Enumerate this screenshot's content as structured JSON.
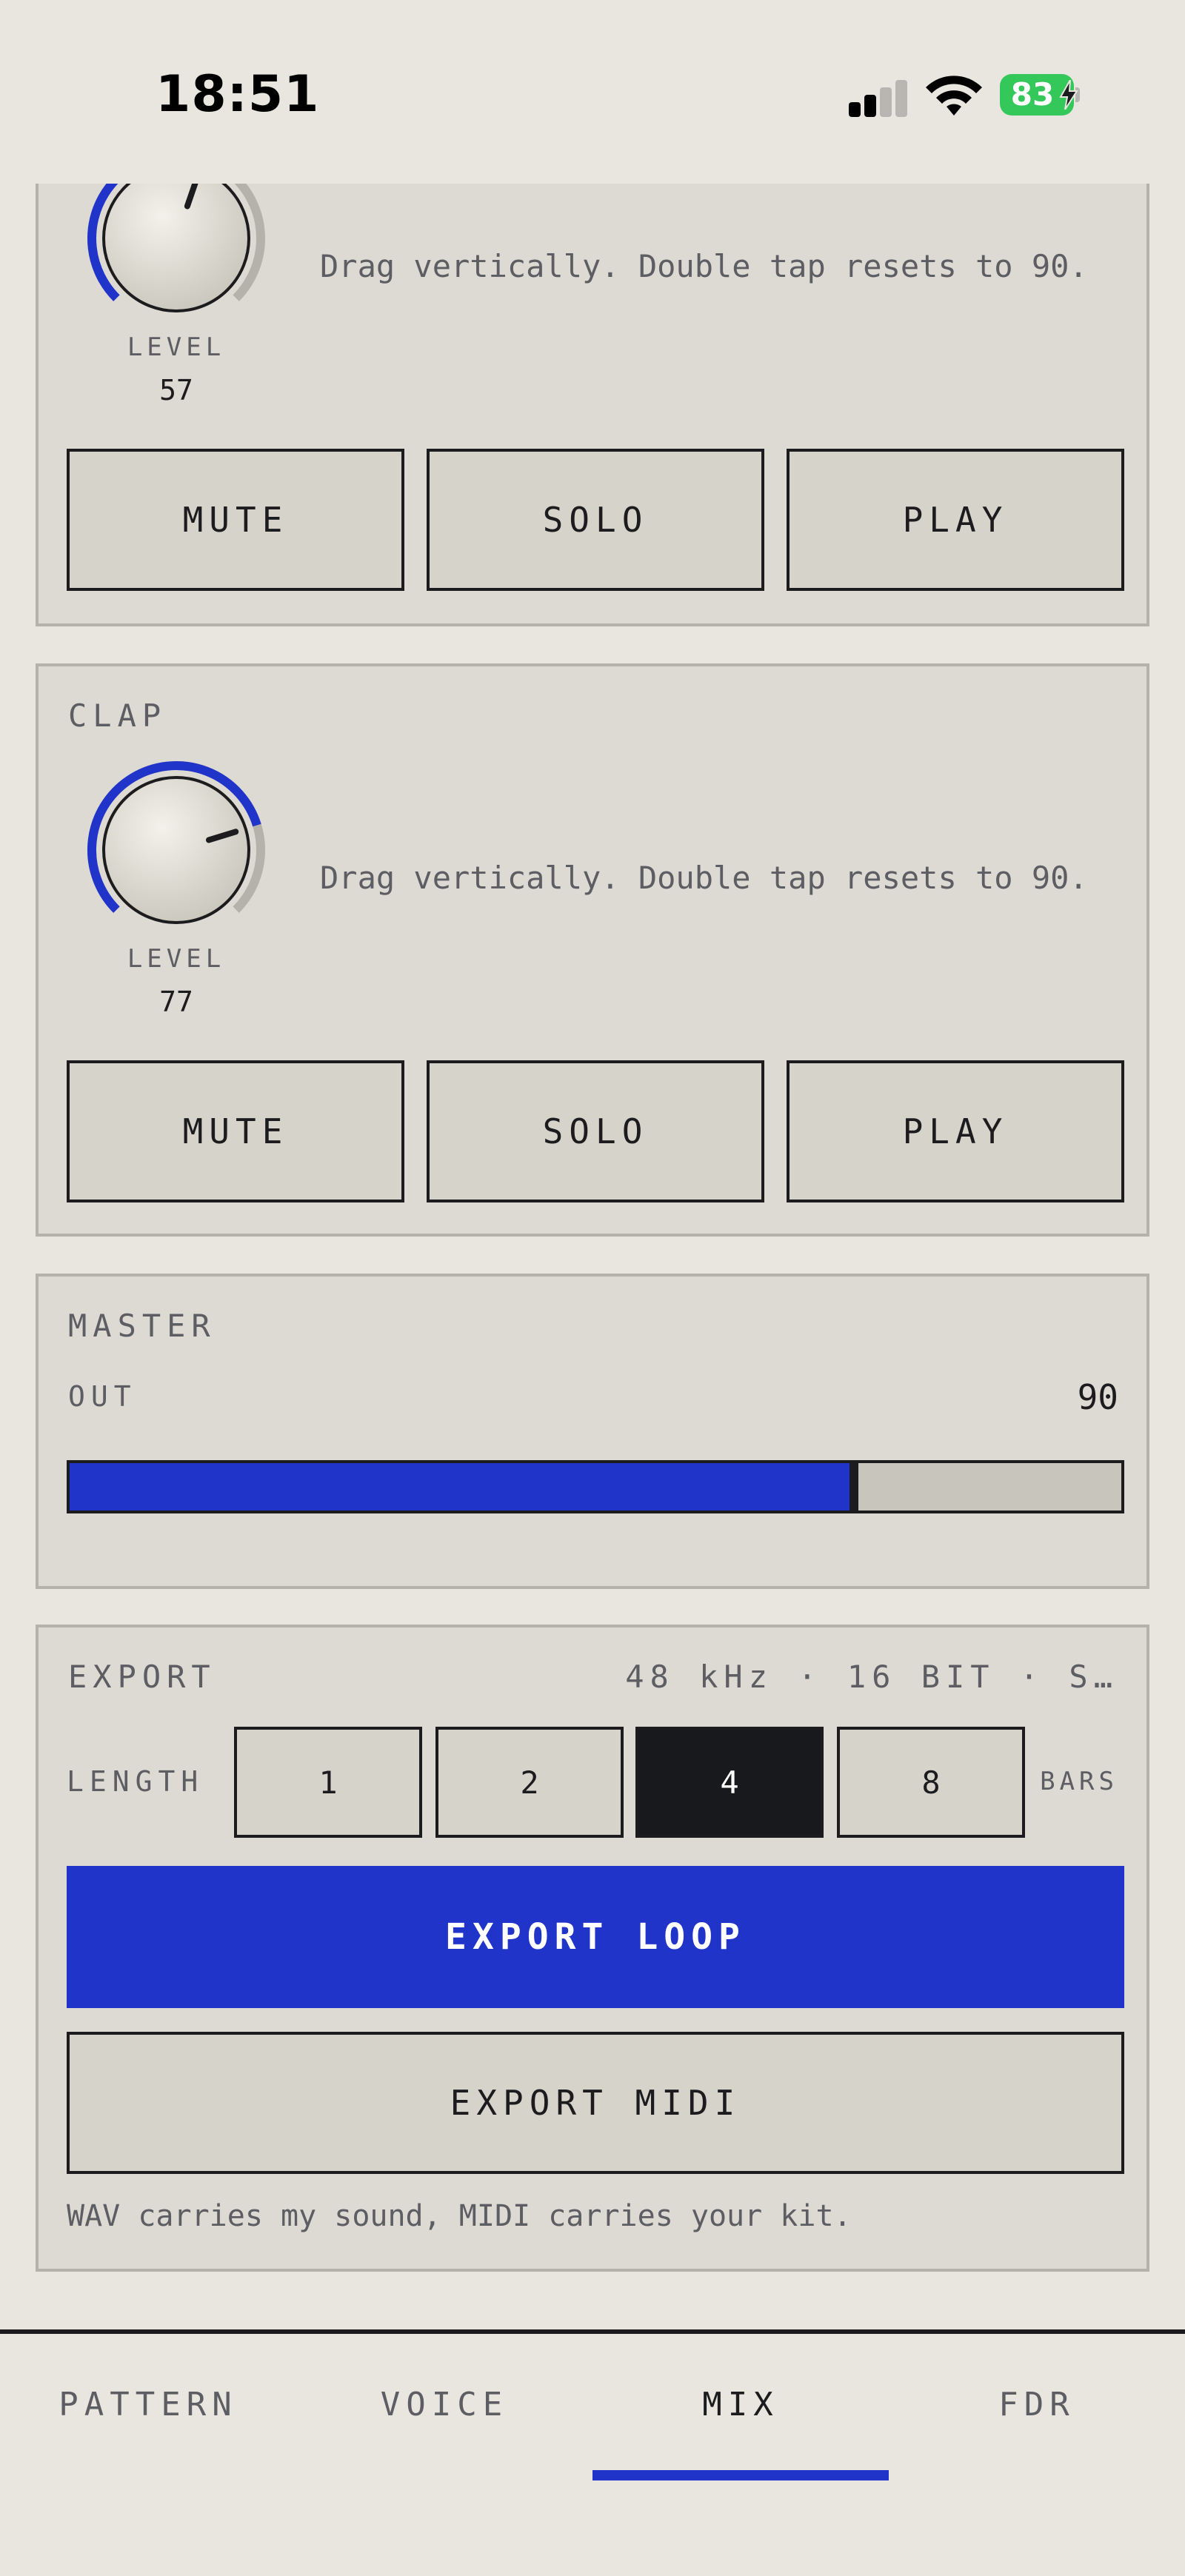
{
  "status_bar": {
    "time": "18:51",
    "battery": "83",
    "icons": [
      "signal-icon",
      "wifi-icon",
      "battery-icon",
      "charging-bolt-icon"
    ]
  },
  "channels": [
    {
      "label": "",
      "knob_label": "LEVEL",
      "level": "57",
      "level_value": 57,
      "hint": "Drag vertically. Double tap resets to 90.",
      "buttons": {
        "mute": "MUTE",
        "solo": "SOLO",
        "play": "PLAY"
      }
    },
    {
      "label": "CLAP",
      "knob_label": "LEVEL",
      "level": "77",
      "level_value": 77,
      "hint": "Drag vertically. Double tap resets to 90.",
      "buttons": {
        "mute": "MUTE",
        "solo": "SOLO",
        "play": "PLAY"
      }
    }
  ],
  "master": {
    "title": "MASTER",
    "out_label": "OUT",
    "out_value": "90",
    "meter_fraction": 0.75
  },
  "export": {
    "title": "EXPORT",
    "format": "48 kHz · 16 BIT · S…",
    "length_label": "LENGTH",
    "lengths": [
      "1",
      "2",
      "4",
      "8"
    ],
    "selected_length": "4",
    "bars_label": "BARS",
    "export_loop": "EXPORT LOOP",
    "export_midi": "EXPORT MIDI",
    "note": "WAV carries my sound, MIDI carries your kit."
  },
  "tabs": [
    {
      "label": "PATTERN",
      "active": false
    },
    {
      "label": "VOICE",
      "active": false
    },
    {
      "label": "MIX",
      "active": true
    },
    {
      "label": "FDR",
      "active": false
    }
  ],
  "colors": {
    "accent": "#2134c9",
    "background": "#e8e6df",
    "card": "#dddad3",
    "ink": "#1c1c1e",
    "muted": "#5d5e63",
    "battery": "#34c759"
  }
}
